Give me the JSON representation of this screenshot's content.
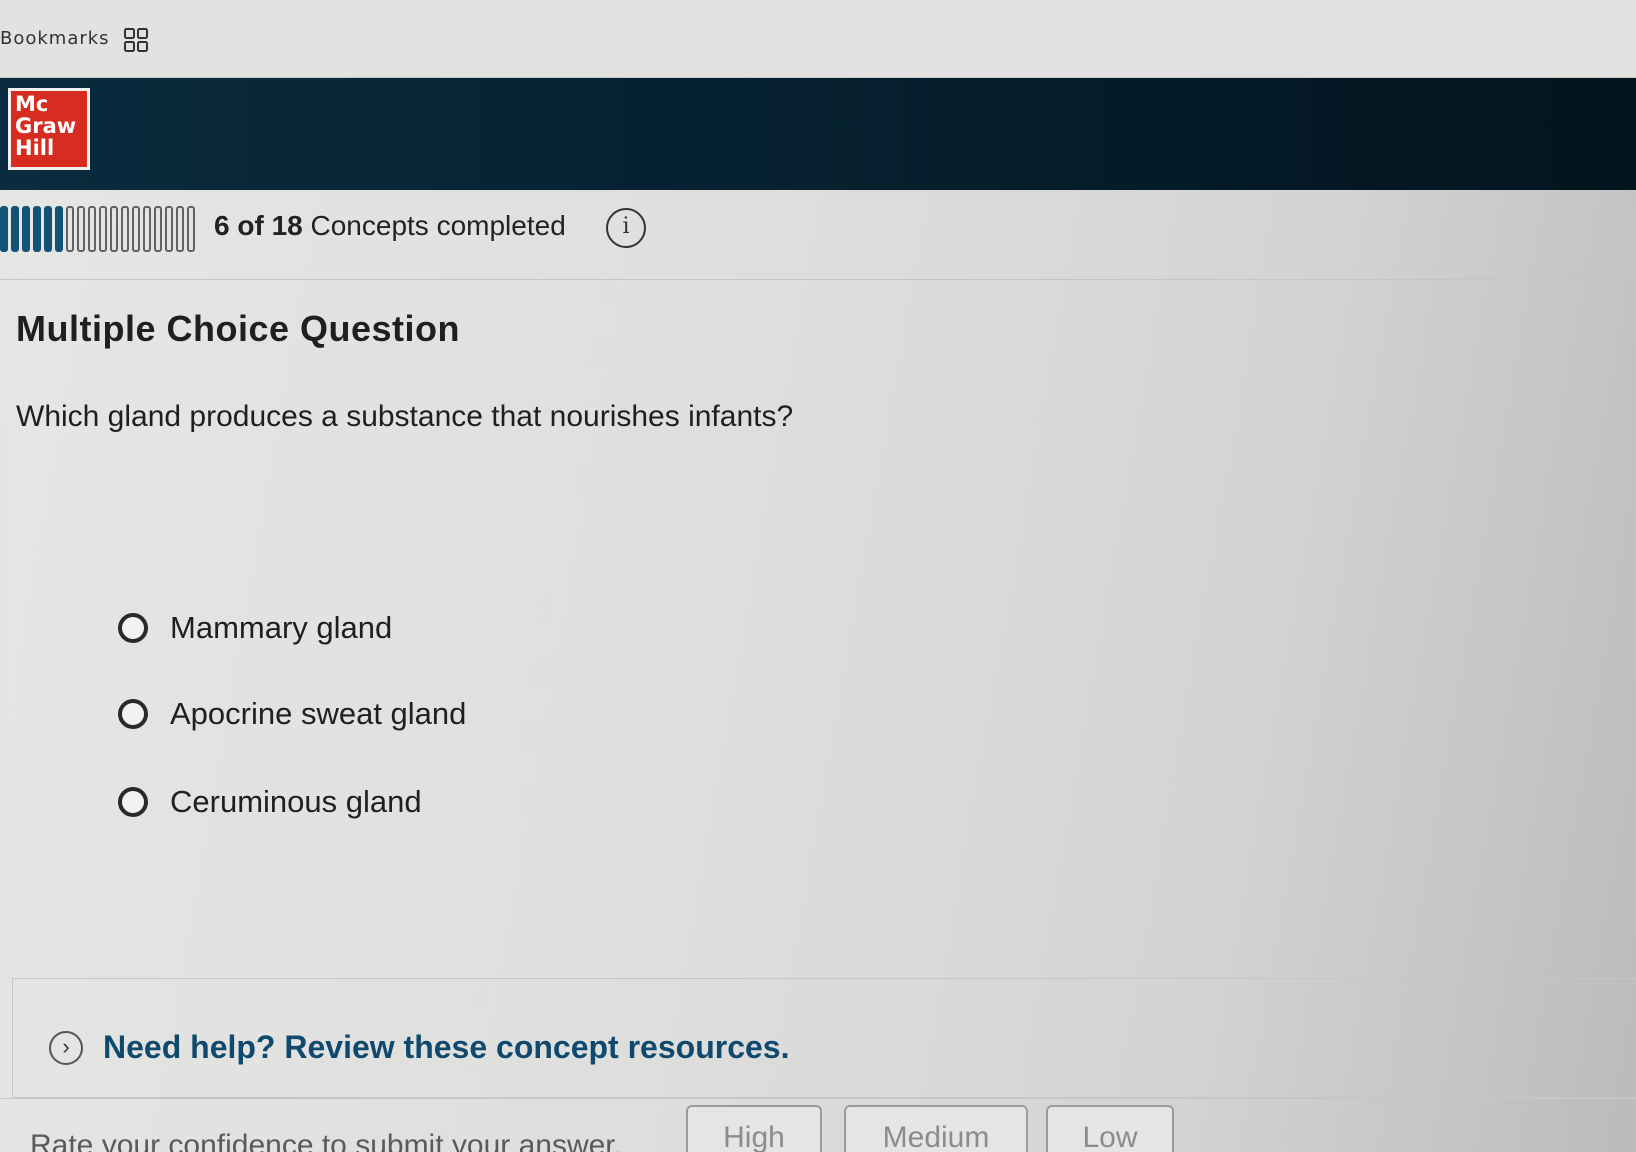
{
  "browser": {
    "bookmarks_label": "Bookmarks",
    "apps_icon": "apps-grid-icon"
  },
  "brand": {
    "logo_lines": [
      "Mc",
      "Graw",
      "Hill"
    ],
    "logo_color": "#d62d20",
    "header_color": "#062232"
  },
  "progress": {
    "completed": "6",
    "of": "of",
    "total": "18",
    "suffix": "Concepts completed",
    "info_icon": "info-icon",
    "completed_count": 6,
    "total_count": 18,
    "accent": "#12537a"
  },
  "question": {
    "type": "Multiple Choice Question",
    "text": "Which gland produces a substance that nourishes infants?",
    "options": [
      {
        "label": "Mammary gland",
        "selected": false
      },
      {
        "label": "Apocrine sweat gland",
        "selected": false
      },
      {
        "label": "Ceruminous gland",
        "selected": false
      }
    ]
  },
  "help": {
    "chevron_icon": "chevron-right-icon",
    "text": "Need help? Review these concept resources.",
    "color": "#0f4a6e"
  },
  "confidence": {
    "prompt": "Rate your confidence to submit your answer.",
    "buttons": [
      "High",
      "Medium",
      "Low"
    ]
  }
}
